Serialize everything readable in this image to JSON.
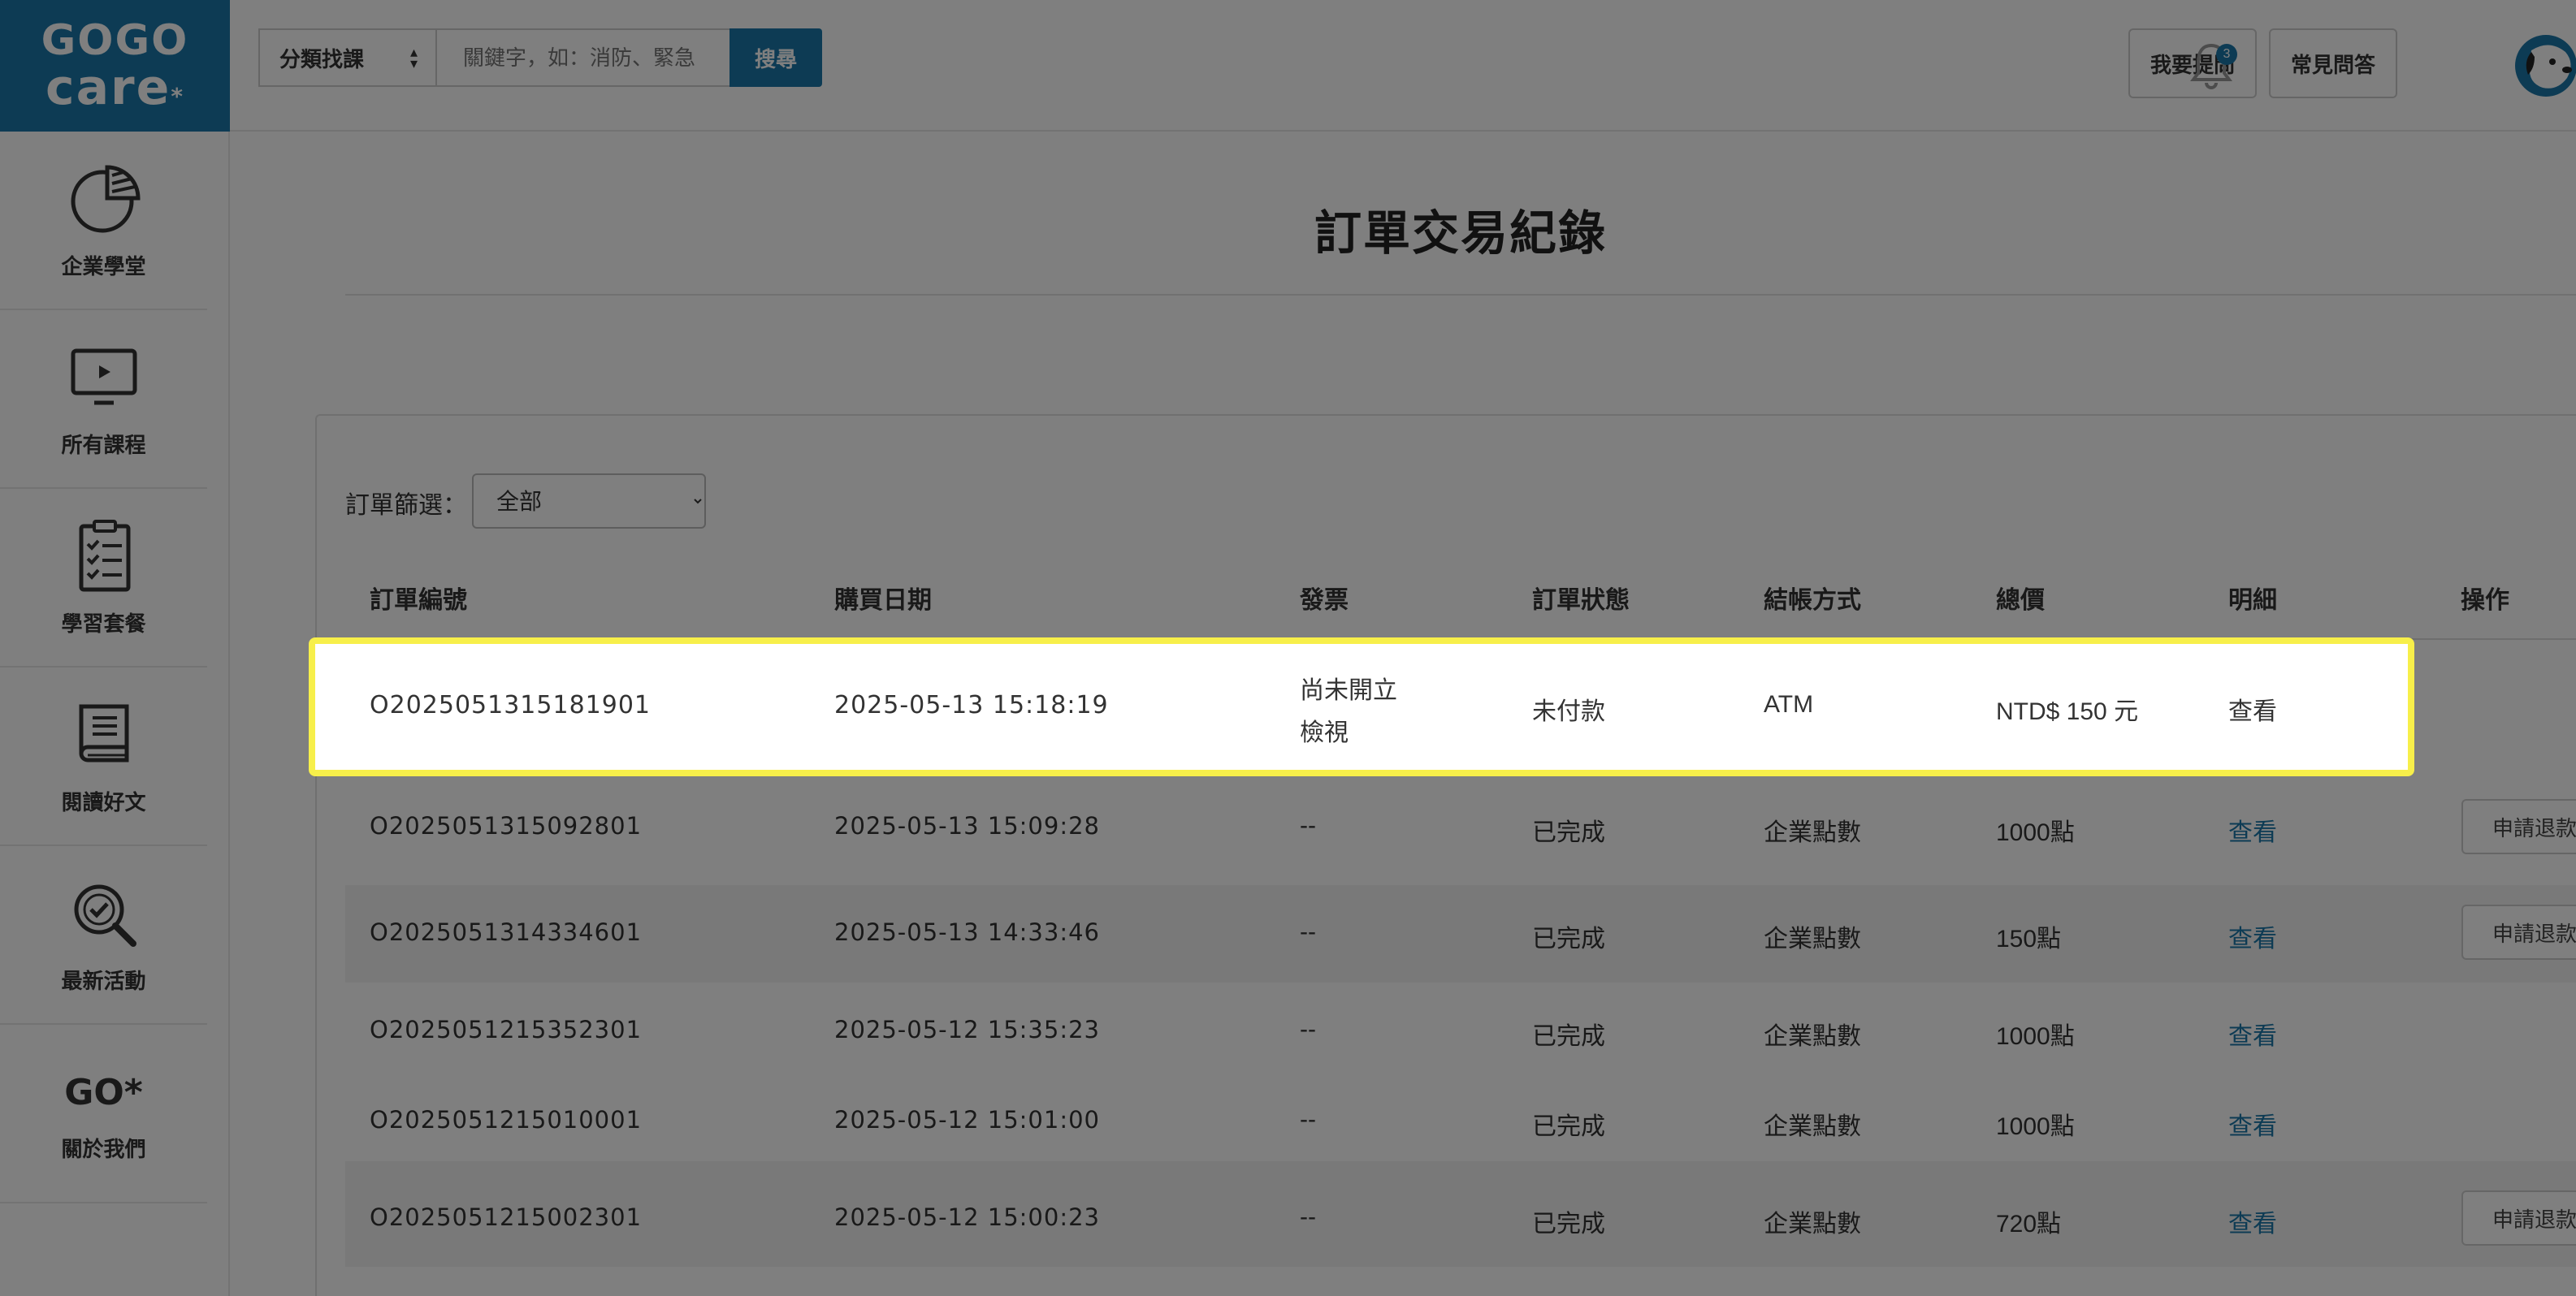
{
  "brand": {
    "line1": "GOGO",
    "line2": "care",
    "star": "*"
  },
  "sidebar": {
    "items": [
      {
        "label": "企業學堂",
        "icon": "pie-chart-icon"
      },
      {
        "label": "所有課程",
        "icon": "monitor-play-icon"
      },
      {
        "label": "學習套餐",
        "icon": "checklist-icon"
      },
      {
        "label": "閱讀好文",
        "icon": "book-icon"
      },
      {
        "label": "最新活動",
        "icon": "magnifier-check-icon"
      },
      {
        "label": "關於我們",
        "icon": "go-logo-icon",
        "logo_text": "GO*"
      }
    ]
  },
  "header": {
    "category_select": "分類找課",
    "search_placeholder": "關鍵字，如：消防、緊急",
    "search_button": "搜尋",
    "ask_button": "我要提問",
    "faq_button": "常見問答",
    "notification_count": "3"
  },
  "page": {
    "title": "訂單交易紀錄"
  },
  "filter": {
    "label": "訂單篩選：",
    "selected": "全部"
  },
  "table": {
    "headers": [
      "訂單編號",
      "購買日期",
      "發票",
      "訂單狀態",
      "結帳方式",
      "總價",
      "明細",
      "操作"
    ],
    "rows": [
      {
        "order_id": "O2025051315181901",
        "date": "2025-05-13 15:18:19",
        "invoice": "尚未開立",
        "invoice_link": "檢視",
        "status": "未付款",
        "payment": "ATM",
        "total": "NTD$ 150 元",
        "detail": "查看",
        "action": ""
      },
      {
        "order_id": "O2025051315092801",
        "date": "2025-05-13 15:09:28",
        "invoice": "--",
        "status": "已完成",
        "payment": "企業點數",
        "total": "1000點",
        "detail": "查看",
        "action": "申請退款"
      },
      {
        "order_id": "O2025051314334601",
        "date": "2025-05-13 14:33:46",
        "invoice": "--",
        "status": "已完成",
        "payment": "企業點數",
        "total": "150點",
        "detail": "查看",
        "action": "申請退款"
      },
      {
        "order_id": "O2025051215352301",
        "date": "2025-05-12 15:35:23",
        "invoice": "--",
        "status": "已完成",
        "payment": "企業點數",
        "total": "1000點",
        "detail": "查看",
        "action": ""
      },
      {
        "order_id": "O2025051215010001",
        "date": "2025-05-12 15:01:00",
        "invoice": "--",
        "status": "已完成",
        "payment": "企業點數",
        "total": "1000點",
        "detail": "查看",
        "action": ""
      },
      {
        "order_id": "O2025051215002301",
        "date": "2025-05-12 15:00:23",
        "invoice": "--",
        "status": "已完成",
        "payment": "企業點數",
        "total": "720點",
        "detail": "查看",
        "action": "申請退款"
      }
    ]
  },
  "colors": {
    "brand": "#1a77a8",
    "highlight_border": "#f7ef4a",
    "overlay": "rgba(0,0,0,0.5)"
  }
}
